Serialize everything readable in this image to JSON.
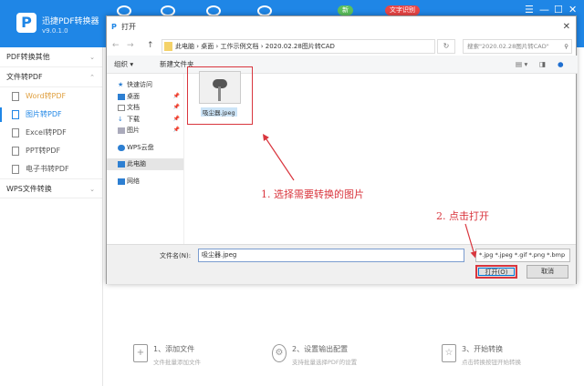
{
  "app": {
    "name": "迅捷PDF转换器",
    "version": "v9.0.1.0",
    "badge_new": "新",
    "badge_ocr": "文字识别",
    "window_controls": [
      "☰",
      "—",
      "☐",
      "✕"
    ]
  },
  "sidebar": {
    "sections": [
      {
        "label": "PDF转换其他",
        "chev": "⌄"
      },
      {
        "label": "文件转PDF",
        "chev": "⌃"
      }
    ],
    "items": [
      {
        "label": "Word转PDF"
      },
      {
        "label": "图片转PDF"
      },
      {
        "label": "Excel转PDF"
      },
      {
        "label": "PPT转PDF"
      },
      {
        "label": "电子书转PDF"
      }
    ],
    "wps": {
      "label": "WPS文件转换",
      "chev": "⌄"
    }
  },
  "dialog": {
    "title": "打开",
    "close": "✕",
    "path": "此电脑  ›  桌面  ›  工作示例文档  ›  2020.02.28图片转CAD",
    "search_placeholder": "搜索\"2020.02.28图片转CAD\"",
    "toolbar": {
      "organize": "组织 ▾",
      "new_folder": "新建文件夹"
    },
    "nav": [
      {
        "label": "快速访问"
      },
      {
        "label": "桌面",
        "pin": "📌"
      },
      {
        "label": "文档",
        "pin": "📌"
      },
      {
        "label": "下载",
        "pin": "📌"
      },
      {
        "label": "图片",
        "pin": "📌"
      },
      {
        "label": "WPS云盘"
      },
      {
        "label": "此电脑"
      },
      {
        "label": "网络"
      }
    ],
    "file": {
      "name": "吸尘器.jpeg"
    },
    "filename_label": "文件名(N):",
    "filename_value": "吸尘器.jpeg",
    "filter": "*.jpg *.jpeg *.gif *.png *.bmp",
    "open": "打开(O)",
    "cancel": "取消"
  },
  "annotations": {
    "step1": "1. 选择需要转换的图片",
    "step2": "2. 点击打开"
  },
  "steps": [
    {
      "title": "1、添加文件",
      "sub": "文件批量添加文件"
    },
    {
      "title": "2、设置输出配置",
      "sub": "支持批量选择PDF的设置"
    },
    {
      "title": "3、开始转换",
      "sub": "点击转换按钮开始转换"
    }
  ]
}
